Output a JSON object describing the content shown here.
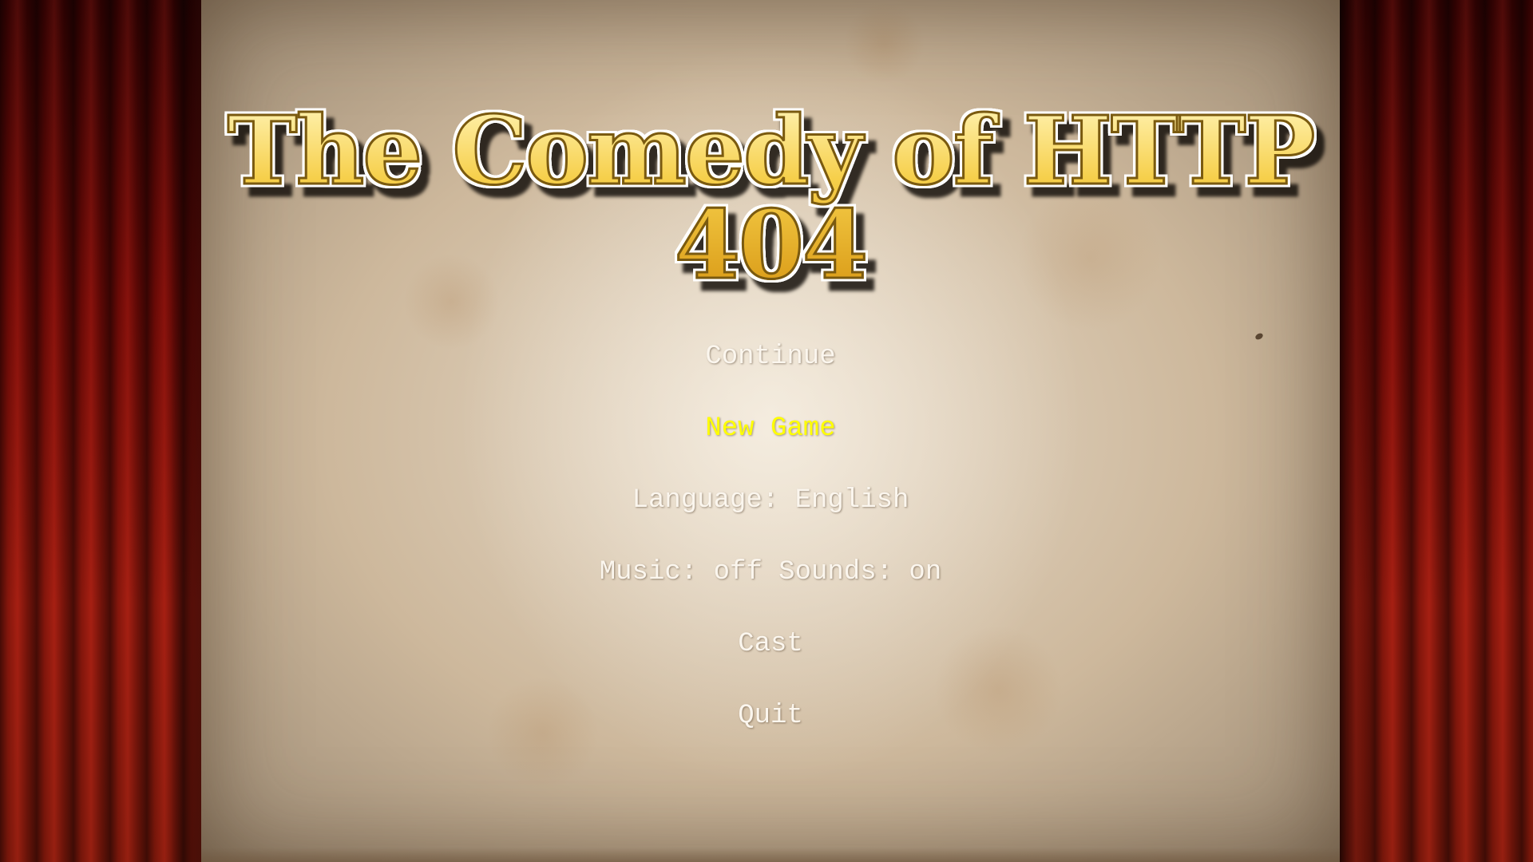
{
  "title": "The Comedy of HTTP 404",
  "menu": {
    "continue": "Continue",
    "new_game": "New Game",
    "language": "Language: English",
    "audio": "Music: off Sounds: on",
    "cast": "Cast",
    "quit": "Quit"
  },
  "selected_item": "New Game",
  "colors": {
    "menu_text": "#fbf6ee",
    "menu_selected": "#ffff00",
    "title_gold": "#f6cf4a",
    "curtain_red": "#9c1a0e",
    "parchment": "#e8dccb"
  }
}
